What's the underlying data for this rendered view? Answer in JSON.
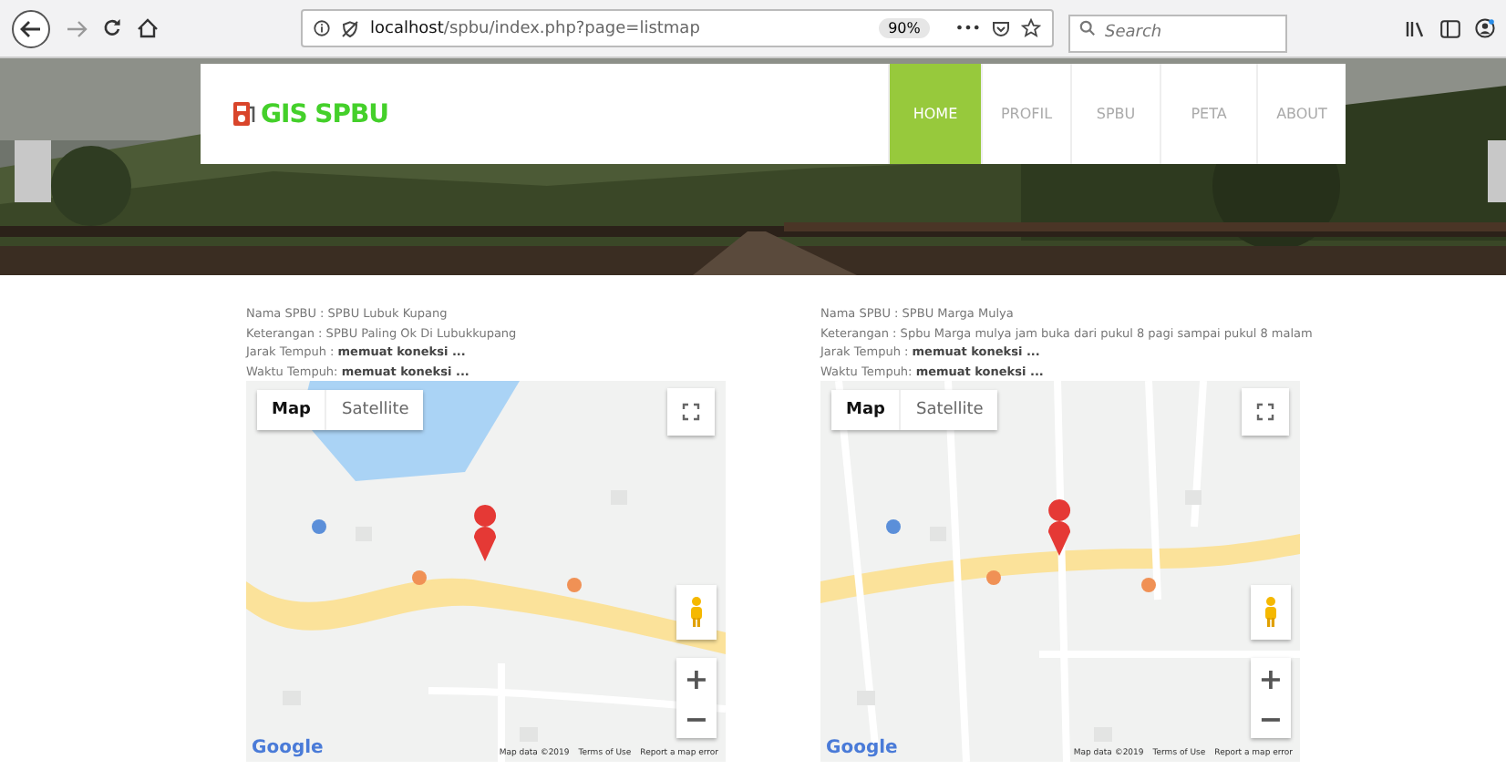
{
  "browser": {
    "url": "**localhost**/spbu/index.php?page=listmap",
    "zoom": "90%",
    "more": "•••",
    "search": {
      "placeholder": "Search"
    }
  },
  "header": {
    "logo": "GIS SPBU",
    "nav": [
      {
        "label": "HOME",
        "selected": true
      },
      {
        "label": "PROFIL",
        "selected": false
      },
      {
        "label": "SPBU",
        "selected": false
      },
      {
        "label": "PETA",
        "selected": false
      },
      {
        "label": "ABOUT",
        "selected": false
      }
    ]
  },
  "stations": [
    {
      "lines": [
        "Nama SPBU : SPBU Lubuk Kupang",
        "Keterangan : SPBU Paling Ok Di Lubukkupang",
        "Jarak Tempuh : **memuat koneksi ...**",
        "Waktu Tempuh: **memuat koneksi ...**"
      ],
      "map": {
        "map_types": [
          {
            "label": "Map",
            "selected": true
          },
          {
            "label": "Satellite",
            "selected": false
          }
        ],
        "zoom_in": "+",
        "zoom_out": "−",
        "brand": "Google",
        "footer": [
          "Map data ©2019",
          "Terms of Use",
          "Report a map error"
        ]
      }
    },
    {
      "lines": [
        "Nama SPBU : SPBU Marga Mulya",
        "Keterangan : Spbu Marga mulya jam buka dari pukul 8 pagi sampai pukul 8 malam",
        "Jarak Tempuh : **memuat koneksi ...**",
        "Waktu Tempuh: **memuat koneksi ...**"
      ],
      "map": {
        "map_types": [
          {
            "label": "Map",
            "selected": true
          },
          {
            "label": "Satellite",
            "selected": false
          }
        ],
        "zoom_in": "+",
        "zoom_out": "−",
        "brand": "Google",
        "footer": [
          "Map data ©2019",
          "Terms of Use",
          "Report a map error"
        ]
      }
    }
  ]
}
